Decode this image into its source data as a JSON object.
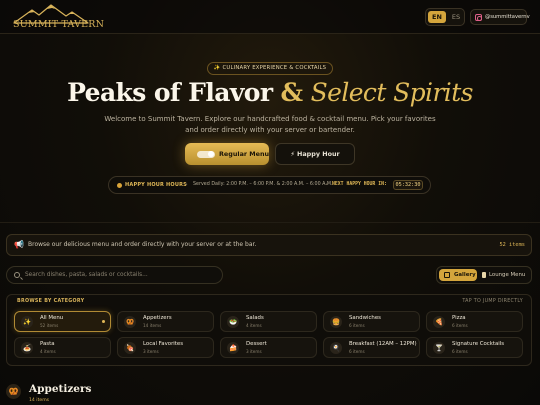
{
  "header": {
    "logo_text": "SUMMIT TAVERN",
    "languages": [
      "EN",
      "ES"
    ],
    "active_language": "EN",
    "instagram_handle": "@summittavernv",
    "instagram_icon": "instagram-icon"
  },
  "hero": {
    "pill_text": "✨ CULINARY EXPERIENCE & COCKTAILS",
    "title_part1": "Peaks of Flavor",
    "title_amp": "&",
    "title_part2": "Select Spirits",
    "subtitle_line1": "Welcome to Summit Tavern. Explore our handcrafted food & cocktail menu. Pick your favorites",
    "subtitle_line2": "and order directly with your server or bartender.",
    "regular_menu_label": "Regular Menu",
    "happy_hour_label": "⚡ Happy Hour",
    "happy_hour_icon": "lightning-icon"
  },
  "happy_hour_bar": {
    "label": "HAPPY HOUR HOURS",
    "served": "Served Daily: 2:00 P.M. – 6:00 P.M. & 2:00 A.M. – 6:00 A.M.",
    "next_label": "NEXT HAPPY HOUR IN:",
    "countdown": "05:32:30"
  },
  "notice": {
    "icon": "megaphone-icon",
    "text": "Browse our delicious menu and order directly with your server or at the bar.",
    "count": "52 items"
  },
  "search": {
    "placeholder": "Search dishes, pasta, salads or cocktails..."
  },
  "view_toggle": {
    "gallery_label": "Gallery",
    "lounge_label": "Lounge Menu",
    "active": "Gallery"
  },
  "categories": {
    "heading": "BROWSE BY CATEGORY",
    "hint": "TAP TO JUMP DIRECTLY",
    "items": [
      {
        "name": "All Menu",
        "count": "52 items",
        "icon": "✨",
        "active": true
      },
      {
        "name": "Appetizers",
        "count": "14 items",
        "icon": "🥨"
      },
      {
        "name": "Salads",
        "count": "4 items",
        "icon": "🥗"
      },
      {
        "name": "Sandwiches",
        "count": "6 items",
        "icon": "🍔"
      },
      {
        "name": "Pizza",
        "count": "6 items",
        "icon": "🍕"
      },
      {
        "name": "Pasta",
        "count": "4 items",
        "icon": "🍝"
      },
      {
        "name": "Local Favorites",
        "count": "3 items",
        "icon": "🍖"
      },
      {
        "name": "Dessert",
        "count": "3 items",
        "icon": "🍰"
      },
      {
        "name": "Breakfast (12AM – 12PM)",
        "count": "6 items",
        "icon": "🍳"
      },
      {
        "name": "Signature Cocktails",
        "count": "6 items",
        "icon": "🍸"
      }
    ]
  },
  "section": {
    "icon": "🥨",
    "title": "Appetizers",
    "count": "14 items"
  },
  "colors": {
    "accent": "#d4a53c",
    "background": "#0d0b08",
    "text": "#e8e2d4"
  }
}
